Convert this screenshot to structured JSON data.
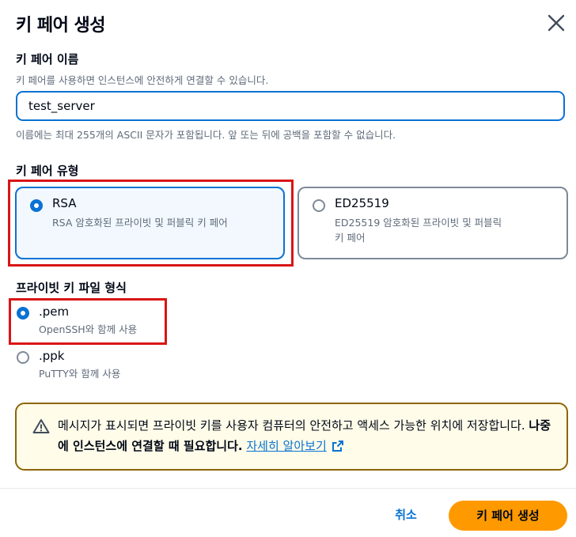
{
  "dialog": {
    "title": "키 페어 생성",
    "close_icon": "close-icon"
  },
  "name_field": {
    "label": "키 페어 이름",
    "description": "키 페어를 사용하면 인스턴스에 안전하게 연결할 수 있습니다.",
    "value": "test_server",
    "constraint": "이름에는 최대 255개의 ASCII 문자가 포함됩니다. 앞 또는 뒤에 공백을 포함할 수 없습니다."
  },
  "key_type": {
    "label": "키 페어 유형",
    "selected": "RSA",
    "options": [
      {
        "title": "RSA",
        "description": "RSA 암호화된 프라이빗 및 퍼블릭 키 페어"
      },
      {
        "title": "ED25519",
        "description_line1": "ED25519 암호화된 프라이빗 및 퍼블릭",
        "description_line2": "키 페어"
      }
    ]
  },
  "file_format": {
    "label": "프라이빗 키 파일 형식",
    "selected": ".pem",
    "options": [
      {
        "title": ".pem",
        "description": "OpenSSH와 함께 사용"
      },
      {
        "title": ".ppk",
        "description": "PuTTY와 함께 사용"
      }
    ]
  },
  "alert": {
    "icon": "warning-icon",
    "text": "메시지가 표시되면 프라이빗 키를 사용자 컴퓨터의 안전하고 액세스 가능한 위치에 저장합니다. ",
    "bold_text": "나중에 인스턴스에 연결할 때 필요합니다.",
    "link_text": "자세히 알아보기",
    "link_icon": "external-link-icon"
  },
  "footer": {
    "cancel_label": "취소",
    "create_label": "키 페어 생성"
  },
  "colors": {
    "accent": "#0972d3",
    "primary_button": "#ff9900",
    "highlight": "#d91515",
    "warning_border": "#8d6605"
  }
}
